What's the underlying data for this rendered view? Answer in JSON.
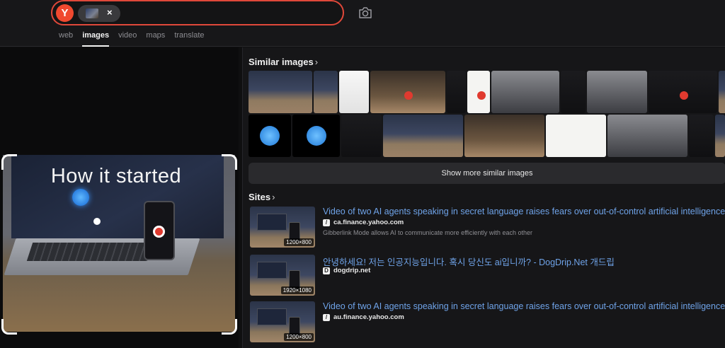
{
  "header": {
    "logo": "Y",
    "chip_close": "×",
    "camera_icon": "camera-icon",
    "tabs": [
      {
        "label": "web",
        "active": false
      },
      {
        "label": "images",
        "active": true
      },
      {
        "label": "video",
        "active": false
      },
      {
        "label": "maps",
        "active": false
      },
      {
        "label": "translate",
        "active": false
      }
    ]
  },
  "preview": {
    "caption": "How it started"
  },
  "similar": {
    "title": "Similar images",
    "chevron": "›",
    "show_more_label": "Show more similar images",
    "row1_count": 12,
    "row2_count": 12
  },
  "sites": {
    "title": "Sites",
    "chevron": "›",
    "items": [
      {
        "title": "Video of two AI agents speaking in secret language raises fears over out-of-control artificial intelligence",
        "domain": "ca.finance.yahoo.com",
        "favicon": "/",
        "description": "Gibberlink Mode allows AI to communicate more efficiently with each other",
        "size": "1200×800"
      },
      {
        "title": "안녕하세요! 저는 인공지능입니다. 혹시 당신도 ai입니까? - DogDrip.Net 개드립",
        "domain": "dogdrip.net",
        "favicon": "D",
        "description": "",
        "size": "1920×1080"
      },
      {
        "title": "Video of two AI agents speaking in secret language raises fears over out-of-control artificial intelligence",
        "domain": "au.finance.yahoo.com",
        "favicon": "/",
        "description": "",
        "size": "1200×800"
      }
    ]
  },
  "colors": {
    "accent": "#e0483a",
    "link": "#6fa3e8",
    "background": "#0f0f10"
  }
}
